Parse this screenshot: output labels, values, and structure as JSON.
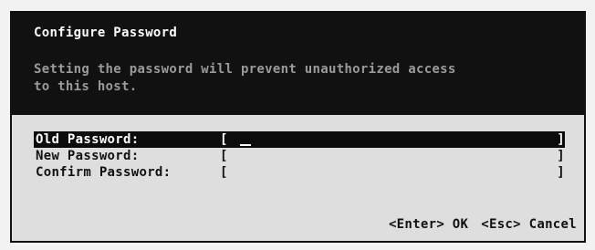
{
  "dialog": {
    "title": "Configure Password",
    "description": "Setting the password will prevent unauthorized access\nto this host."
  },
  "fields": [
    {
      "label": "Old Password:",
      "bracket_open": "[",
      "bracket_close": "]",
      "value": "",
      "focused": true
    },
    {
      "label": "New Password:",
      "bracket_open": "[",
      "bracket_close": "]",
      "value": "",
      "focused": false
    },
    {
      "label": "Confirm Password:",
      "bracket_open": "[",
      "bracket_close": "]",
      "value": "",
      "focused": false
    }
  ],
  "footer": {
    "ok_label": "<Enter> OK",
    "cancel_label": "<Esc> Cancel"
  },
  "colors": {
    "header_bg": "#111111",
    "description_text": "#9a9a9a",
    "dialog_bg": "#dedede",
    "focus_bar": "#0c0c0c"
  }
}
